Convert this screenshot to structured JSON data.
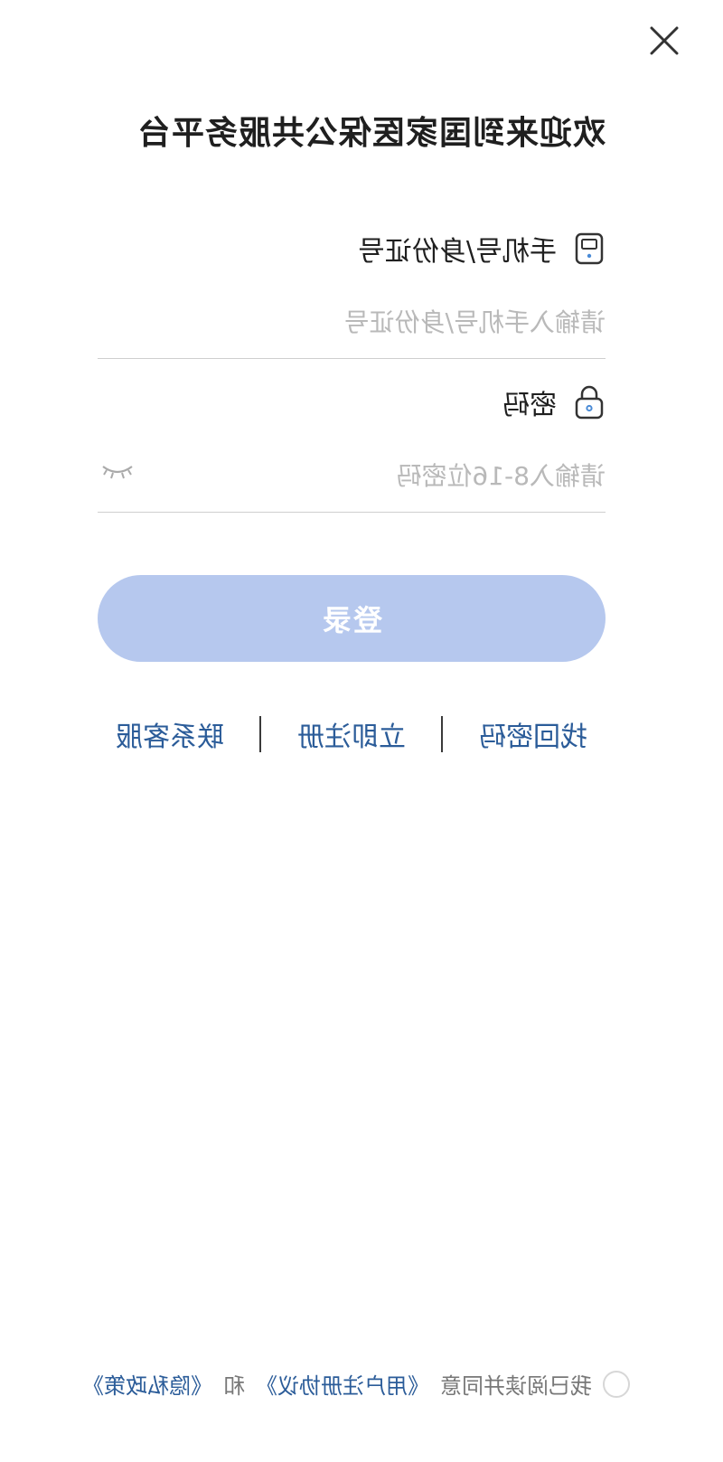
{
  "header": {
    "close_icon": "close-icon",
    "title": "欢迎来到国家医保公共服务平台"
  },
  "form": {
    "account": {
      "label": "手机号/身份证号",
      "icon": "phone-icon",
      "placeholder": "请输入手机号/身份证号",
      "value": ""
    },
    "password": {
      "label": "密码",
      "icon": "lock-icon",
      "placeholder": "请输入8-16位密码",
      "value": "",
      "toggle_icon": "eye-closed-icon"
    },
    "login_label": "登录"
  },
  "links": {
    "forgot": "找回密码",
    "register": "立即注册",
    "contact": "联系客服"
  },
  "agreement": {
    "prefix": "我已阅读并同意",
    "user_agreement": "《用户注册协议》",
    "and": "和",
    "privacy_policy": "《隐私政策》"
  },
  "colors": {
    "accent": "#2b5c99",
    "button_disabled": "#b6c8ee",
    "text": "#1f1f1f",
    "placeholder": "#b9b9b9"
  }
}
